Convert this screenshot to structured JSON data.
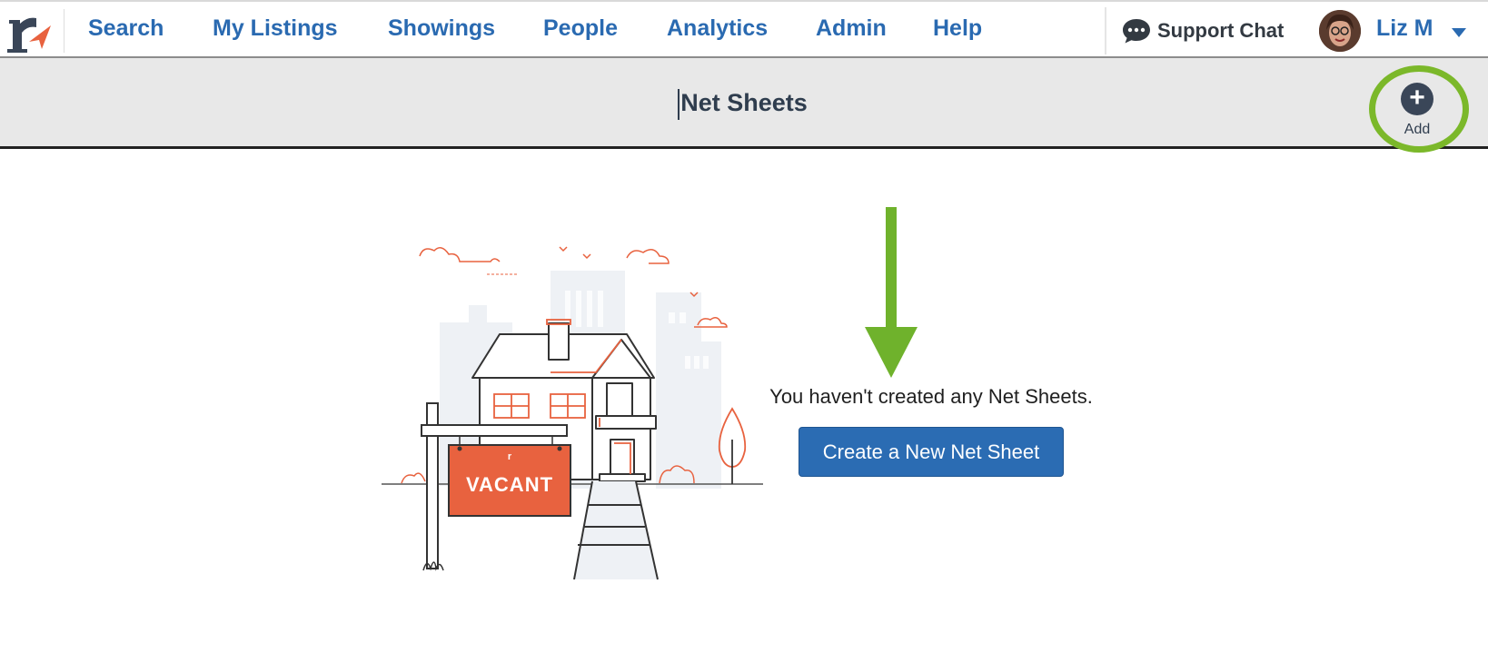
{
  "nav": {
    "items": [
      {
        "label": "Search"
      },
      {
        "label": "My Listings"
      },
      {
        "label": "Showings"
      },
      {
        "label": "People"
      },
      {
        "label": "Analytics"
      },
      {
        "label": "Admin"
      },
      {
        "label": "Help"
      }
    ],
    "support_label": "Support Chat",
    "user_name": "Liz M"
  },
  "titlebar": {
    "title": "Net Sheets",
    "add_label": "Add",
    "add_glyph": "+"
  },
  "empty_state": {
    "message": "You haven't created any Net Sheets.",
    "create_label": "Create a New Net Sheet",
    "sign_text": "VACANT"
  },
  "colors": {
    "brand_blue": "#2a6ab1",
    "accent_orange": "#e8623f",
    "highlight_green": "#7bb82a",
    "titlebar_bg": "#e8e8e8"
  },
  "icons": [
    "logo-icon",
    "chat-icon",
    "avatar",
    "chevron-down-icon",
    "plus-icon",
    "arrow-down-icon"
  ]
}
